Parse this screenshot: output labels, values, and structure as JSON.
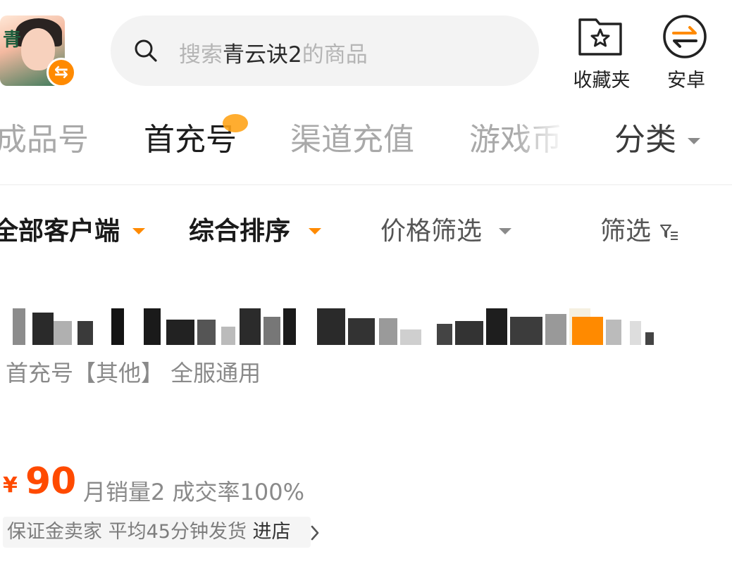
{
  "header": {
    "game_title_glyph": "青",
    "game_badge_glyph": "⇆",
    "search": {
      "prefix": "搜索",
      "game_name": "青云诀2",
      "suffix": "的商品"
    },
    "favorites_label": "收藏夹",
    "platform_label": "安卓"
  },
  "tabs": [
    {
      "label": "成品号",
      "active": false
    },
    {
      "label": "首充号",
      "active": true
    },
    {
      "label": "渠道充值",
      "active": false
    },
    {
      "label": "游戏币",
      "active": false
    },
    {
      "label": "分类",
      "active": false
    }
  ],
  "filters": {
    "client": "全部客户端",
    "sort": "综合排序",
    "price": "价格筛选",
    "filter": "筛选"
  },
  "product": {
    "tags": "首充号【其他】 全服通用",
    "price_symbol": "¥",
    "price": "90",
    "sales_text": "月销量2 成交率100%",
    "seller_text": "保证金卖家 平均45分钟发货",
    "enter_store": "进店"
  },
  "colors": {
    "accent": "#ff8a00",
    "price": "#ff4a00",
    "inactive_tab": "#a9a9a9"
  }
}
